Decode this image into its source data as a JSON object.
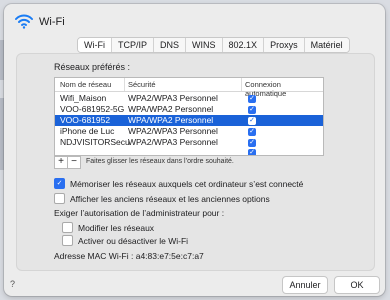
{
  "window": {
    "title": "Wi-Fi"
  },
  "tabs": [
    "Wi-Fi",
    "TCP/IP",
    "DNS",
    "WINS",
    "802.1X",
    "Proxys",
    "Matériel"
  ],
  "networks": {
    "section_label": "Réseaux préférés :",
    "columns": [
      "Nom de réseau",
      "Sécurité",
      "Connexion automatique"
    ],
    "rows": [
      {
        "name": "Wifi_Maison",
        "security": "WPA2/WPA3 Personnel",
        "auto": true,
        "selected": false
      },
      {
        "name": "VOO-681952-5G",
        "security": "WPA/WPA2 Personnel",
        "auto": true,
        "selected": false
      },
      {
        "name": "VOO-681952",
        "security": "WPA/WPA2 Personnel",
        "auto": true,
        "selected": true
      },
      {
        "name": "iPhone de Luc",
        "security": "WPA2/WPA3 Personnel",
        "auto": true,
        "selected": false
      },
      {
        "name": "NDJVISITORSecu",
        "security": "WPA2/WPA3 Personnel",
        "auto": true,
        "selected": false
      }
    ],
    "add_label": "+",
    "remove_label": "−",
    "drag_hint": "Faites glisser les réseaux dans l’ordre souhaité."
  },
  "options": {
    "remember_label": "Mémoriser les réseaux auxquels cet ordinateur s’est connecté",
    "remember_checked": true,
    "show_legacy_label": "Afficher les anciens réseaux et les anciennes options",
    "show_legacy_checked": false,
    "admin_heading": "Exiger l’autorisation de l’administrateur pour :",
    "modify_label": "Modifier les réseaux",
    "modify_checked": false,
    "toggle_label": "Activer ou désactiver le Wi-Fi",
    "toggle_checked": false
  },
  "mac": {
    "label": "Adresse MAC Wi-Fi :",
    "value": "a4:83:e7:5e:c7:a7"
  },
  "footer": {
    "help_label": "?",
    "cancel_label": "Annuler",
    "ok_label": "OK"
  },
  "colors": {
    "accent": "#2a6ff0",
    "selection": "#1a62d8"
  }
}
